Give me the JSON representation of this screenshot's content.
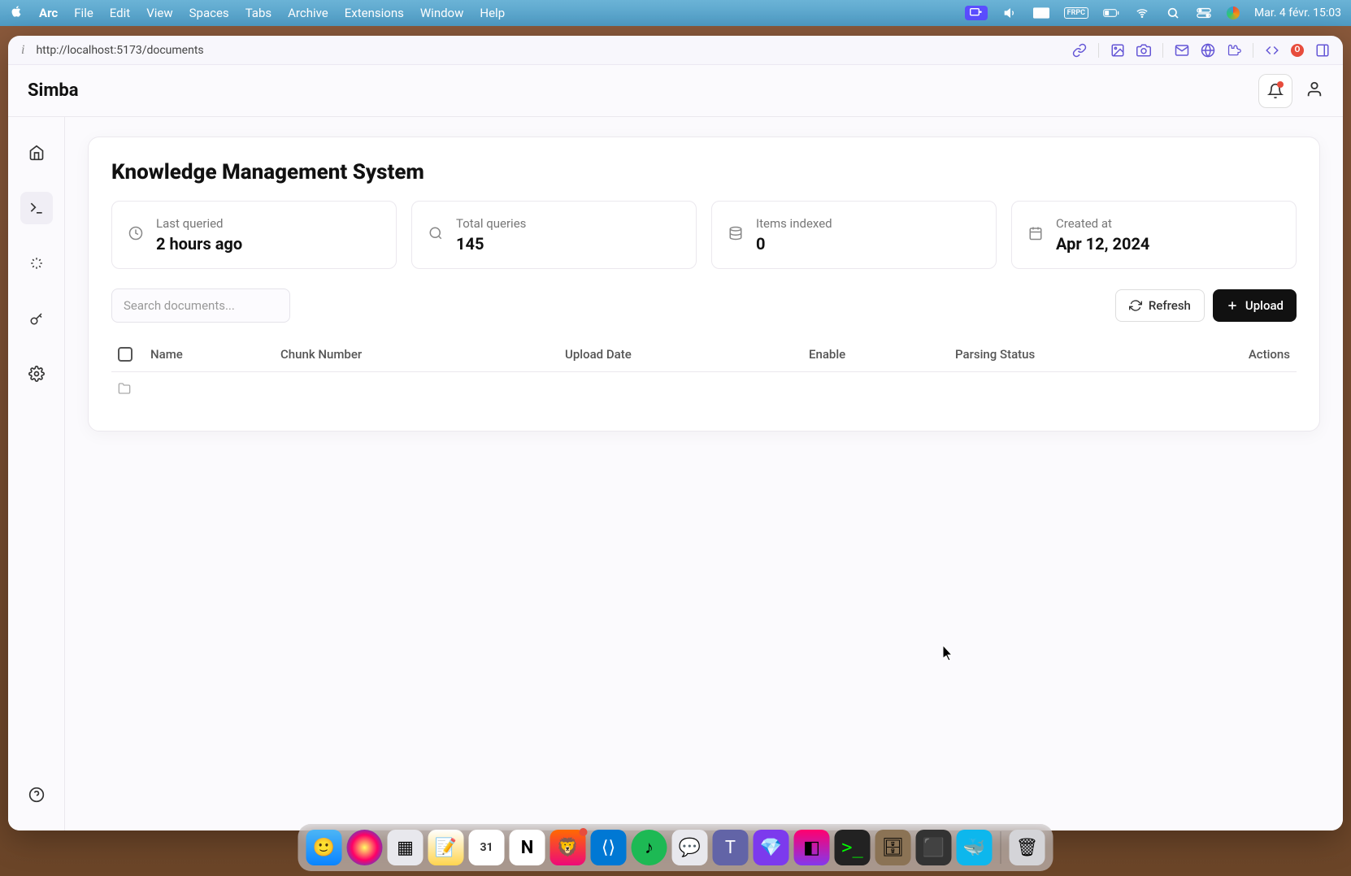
{
  "menubar": {
    "app_name": "Arc",
    "items": [
      "File",
      "Edit",
      "View",
      "Spaces",
      "Tabs",
      "Archive",
      "Extensions",
      "Window",
      "Help"
    ],
    "fps_label": "FRPC",
    "datetime": "Mar. 4 févr.  15:03"
  },
  "url_bar": {
    "url": "http://localhost:5173/documents"
  },
  "app": {
    "title": "Simba"
  },
  "page": {
    "title": "Knowledge Management System"
  },
  "stats": [
    {
      "icon": "clock",
      "label": "Last queried",
      "value": "2 hours ago"
    },
    {
      "icon": "search",
      "label": "Total queries",
      "value": "145"
    },
    {
      "icon": "database",
      "label": "Items indexed",
      "value": "0"
    },
    {
      "icon": "calendar",
      "label": "Created at",
      "value": "Apr 12, 2024"
    }
  ],
  "toolbar": {
    "search_placeholder": "Search documents...",
    "refresh_label": "Refresh",
    "upload_label": "Upload"
  },
  "table": {
    "columns": {
      "name": "Name",
      "chunk": "Chunk Number",
      "date": "Upload Date",
      "enable": "Enable",
      "parsing": "Parsing Status",
      "actions": "Actions"
    }
  },
  "sidebar": {
    "items": [
      {
        "name": "home",
        "active": false
      },
      {
        "name": "terminal",
        "active": true
      },
      {
        "name": "sparkle",
        "active": false
      },
      {
        "name": "key",
        "active": false
      },
      {
        "name": "settings",
        "active": false
      }
    ]
  },
  "dock": {
    "apps": [
      "finder",
      "siri",
      "launchpad",
      "notes",
      "calendar",
      "notion",
      "brave",
      "vscode",
      "spotify",
      "teams",
      "teams2",
      "obsidian",
      "jetbrains",
      "terminal",
      "dbeaver",
      "iterm",
      "docker"
    ],
    "trash": "trash"
  }
}
